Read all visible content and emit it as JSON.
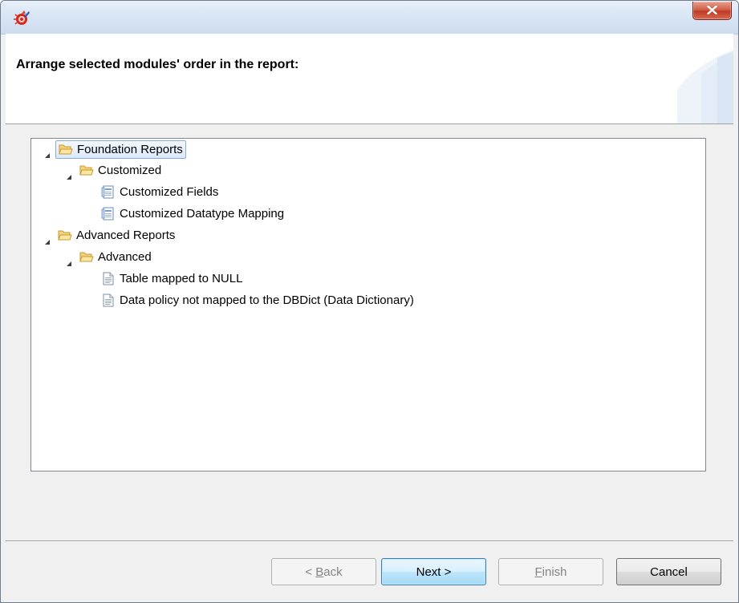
{
  "window": {
    "app_icon": "eclipse-like-app-icon",
    "close_icon": "close-icon",
    "colors": {
      "titlebar": "#d9e6f5",
      "close": "#c9432c",
      "selection_border": "#84acdd"
    }
  },
  "header": {
    "title": "Arrange selected modules' order in the report:"
  },
  "tree": {
    "nodes": [
      {
        "label": "Foundation Reports",
        "type": "folder",
        "level": 0,
        "expanded": true,
        "selected": true
      },
      {
        "label": "Customized",
        "type": "folder",
        "level": 1,
        "expanded": true
      },
      {
        "label": "Customized Fields",
        "type": "report-doc",
        "level": 2
      },
      {
        "label": "Customized Datatype Mapping",
        "type": "report-doc",
        "level": 2
      },
      {
        "label": "Advanced Reports",
        "type": "folder",
        "level": 0,
        "expanded": true
      },
      {
        "label": "Advanced",
        "type": "folder",
        "level": 1,
        "expanded": true
      },
      {
        "label": "Table mapped to NULL",
        "type": "document",
        "level": 2
      },
      {
        "label": "Data policy not mapped to the DBDict (Data Dictionary)",
        "type": "document",
        "level": 2
      }
    ]
  },
  "buttons": {
    "back": {
      "prefix": "< ",
      "mnemonic": "B",
      "rest": "ack",
      "enabled": false
    },
    "next": {
      "label": "Next >",
      "enabled": true,
      "default": true
    },
    "finish": {
      "mnemonic": "F",
      "rest": "inish",
      "enabled": false
    },
    "cancel": {
      "label": "Cancel",
      "enabled": true
    }
  }
}
